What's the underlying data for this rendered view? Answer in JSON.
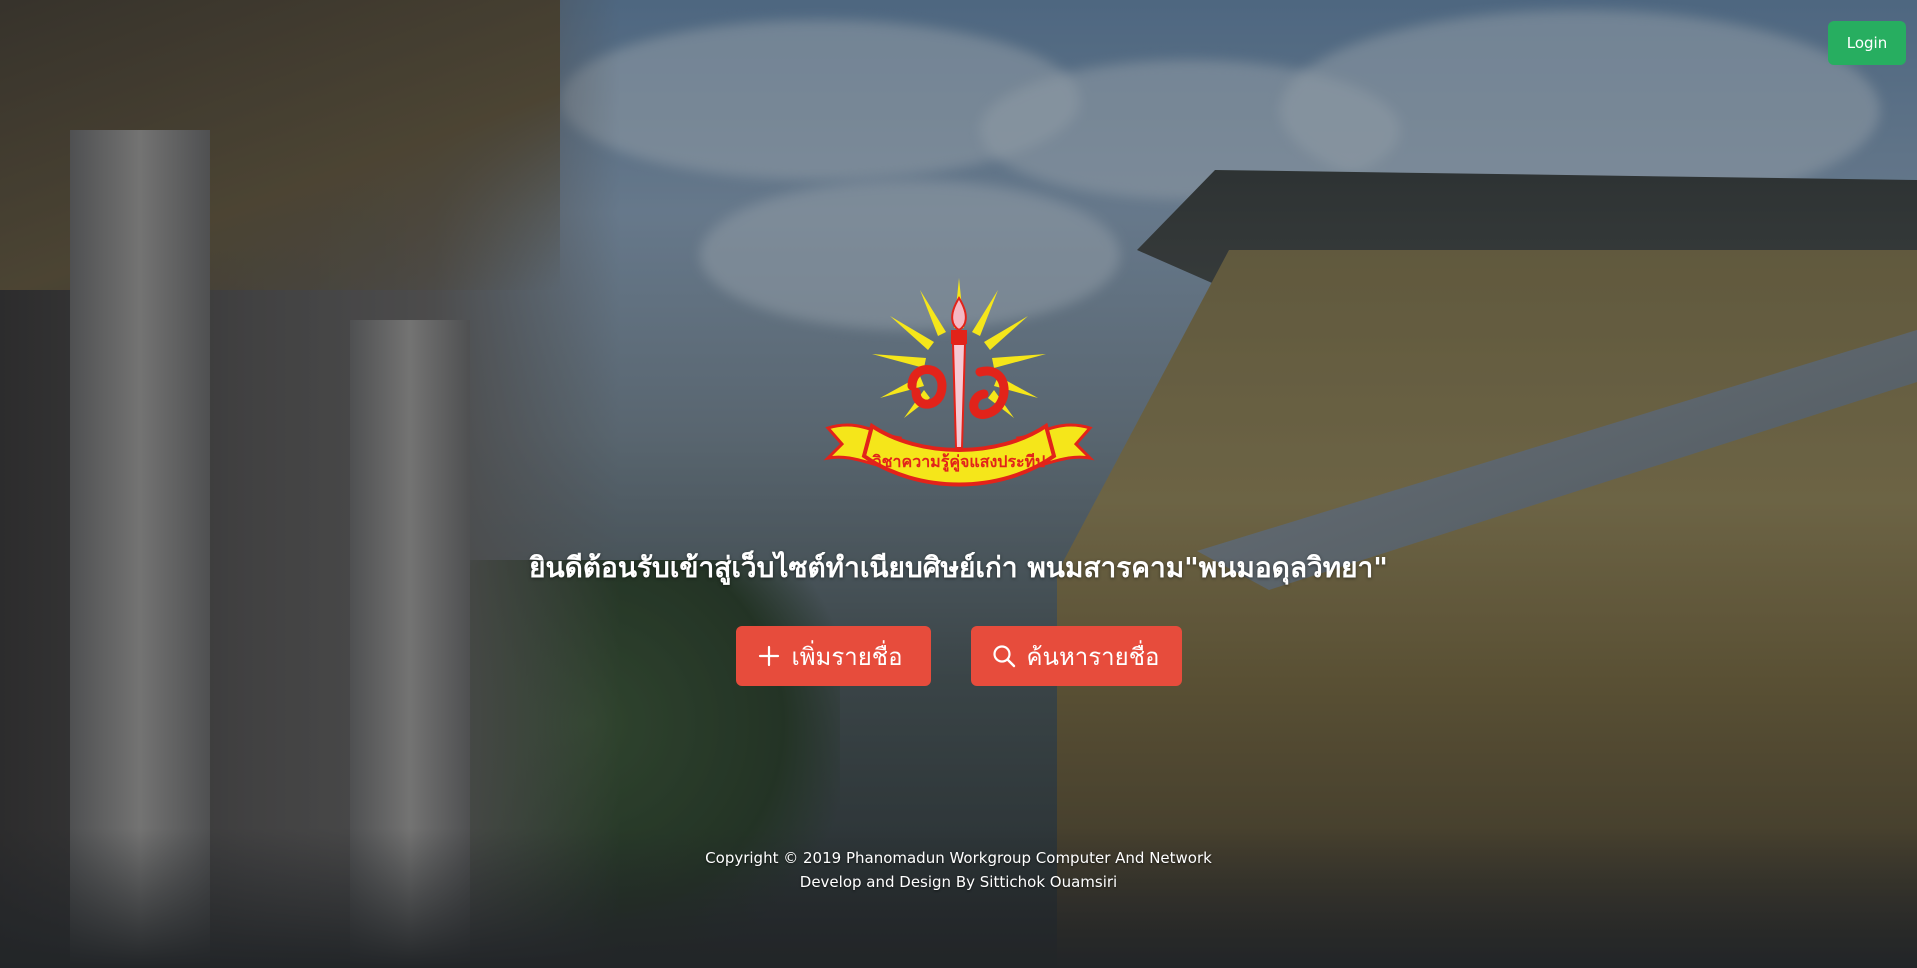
{
  "header": {
    "login_label": "Login"
  },
  "hero": {
    "logo": {
      "emblem_text": "วิชาความรู้คู่จแสงประทีป"
    },
    "welcome_text": "ยินดีต้อนรับเข้าสู่เว็บไซต์ทำเนียบศิษย์เก่า พนมสารคาม\"พนมอดุลวิทยา\"",
    "buttons": [
      {
        "label": "เพิ่มรายชื่อ",
        "icon": "plus-icon"
      },
      {
        "label": "ค้นหารายชื่อ",
        "icon": "search-icon"
      }
    ]
  },
  "footer": {
    "copyright": "Copyright © 2019 Phanomadun Workgroup Computer And Network",
    "credit": "Develop and Design By Sittichok Ouamsiri"
  },
  "colors": {
    "login_button": "#27ae60",
    "action_button": "#e74c3c",
    "logo_yellow": "#f5e61a",
    "logo_red": "#e2231a"
  }
}
